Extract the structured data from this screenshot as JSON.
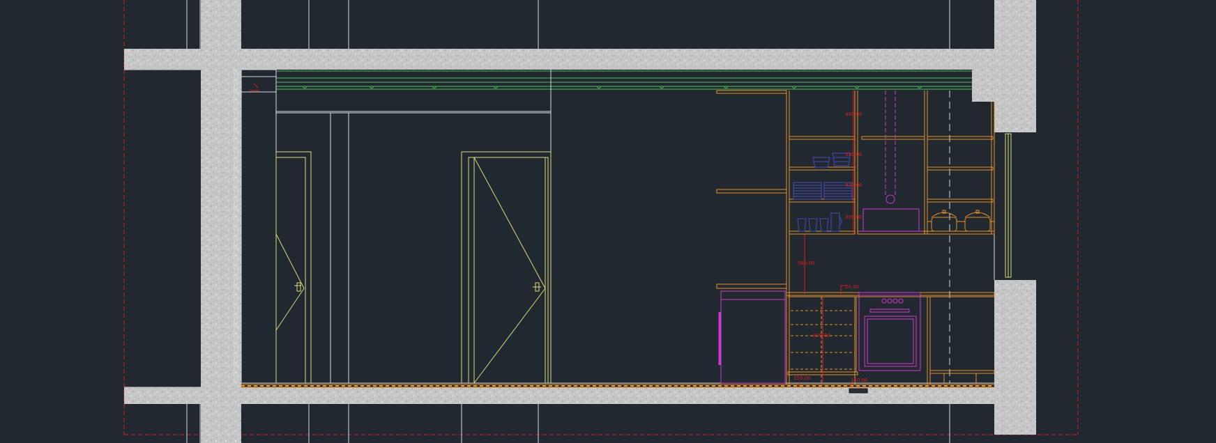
{
  "drawing": {
    "type": "CAD section elevation",
    "background": "#212830",
    "colors": {
      "concrete": "#c4c4c4",
      "line_white": "#d8dde2",
      "door_yellow": "#d9e07a",
      "cabinet_orange": "#e8922a",
      "appliance_magenta": "#d13ad1",
      "dishes_blue": "#4a4cb8",
      "ceiling_green": "#4cc05a",
      "dimension_red": "#e02020"
    },
    "dimensions": [
      {
        "id": "d1",
        "text": "400.00"
      },
      {
        "id": "d2",
        "text": "320.00"
      },
      {
        "id": "d3",
        "text": "320.00"
      },
      {
        "id": "d4",
        "text": "300.00"
      },
      {
        "id": "d5",
        "text": "560.00"
      },
      {
        "id": "d6",
        "text": "20.00"
      },
      {
        "id": "d7",
        "text": "820.00"
      },
      {
        "id": "d8",
        "text": "150.00"
      },
      {
        "id": "d9",
        "text": "150.00"
      }
    ]
  }
}
